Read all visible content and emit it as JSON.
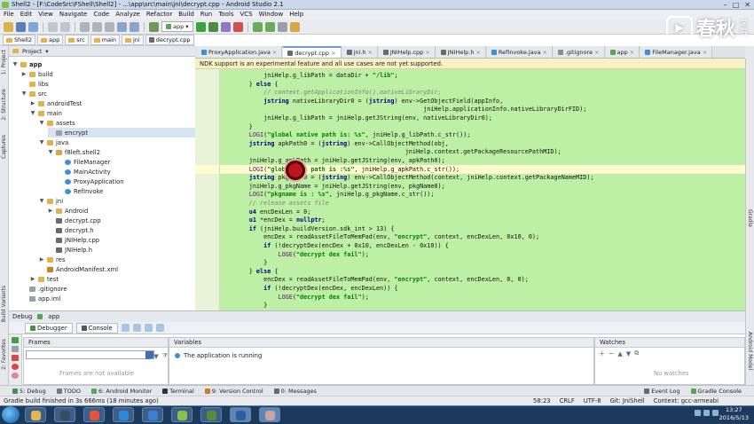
{
  "window": {
    "title": "Shell2 - [F:\\CodeSrc\\FShell\\Shell2] - ...\\app\\src\\main\\jni\\decrypt.cpp - Android Studio 2.1"
  },
  "menu": [
    "File",
    "Edit",
    "View",
    "Navigate",
    "Code",
    "Analyze",
    "Refactor",
    "Build",
    "Run",
    "Tools",
    "VCS",
    "Window",
    "Help"
  ],
  "toolbar": {
    "run_config": "app"
  },
  "watermark": {
    "text": "春秋",
    "sub": "学院"
  },
  "breadcrumb": [
    "Shell2",
    "app",
    "src",
    "main",
    "jni",
    "decrypt.cpp"
  ],
  "tabs": [
    {
      "label": "ProxyApplication.java",
      "color": "#3f8fd6",
      "active": false
    },
    {
      "label": "decrypt.cpp",
      "color": "#6a6a6a",
      "active": true
    },
    {
      "label": "jni.h",
      "color": "#6a6a6a",
      "active": false
    },
    {
      "label": "JNIHelp.cpp",
      "color": "#6a6a6a",
      "active": false
    },
    {
      "label": "JNIHelp.h",
      "color": "#6a6a6a",
      "active": false
    },
    {
      "label": "RefInvoke.java",
      "color": "#3f8fd6",
      "active": false
    },
    {
      "label": ".gitignore",
      "color": "#8c8c8c",
      "active": false
    },
    {
      "label": "app",
      "color": "#5aa35a",
      "active": false
    },
    {
      "label": "FileManager.java",
      "color": "#3f8fd6",
      "active": false
    }
  ],
  "project": {
    "header": "Project",
    "tree": [
      {
        "label": "app",
        "depth": 0,
        "arrow": "▼",
        "icon": "folder",
        "bold": true
      },
      {
        "label": "build",
        "depth": 1,
        "arrow": "▶",
        "icon": "folder"
      },
      {
        "label": "libs",
        "depth": 1,
        "arrow": "",
        "icon": "folder"
      },
      {
        "label": "src",
        "depth": 1,
        "arrow": "▼",
        "icon": "folder"
      },
      {
        "label": "androidTest",
        "depth": 2,
        "arrow": "▶",
        "icon": "folder"
      },
      {
        "label": "main",
        "depth": 2,
        "arrow": "▼",
        "icon": "folder"
      },
      {
        "label": "assets",
        "depth": 3,
        "arrow": "▼",
        "icon": "folder"
      },
      {
        "label": "encrypt",
        "depth": 4,
        "arrow": "",
        "icon": "file",
        "selected": true
      },
      {
        "label": "java",
        "depth": 3,
        "arrow": "▼",
        "icon": "folder"
      },
      {
        "label": "f8left.shell2",
        "depth": 4,
        "arrow": "▼",
        "icon": "package"
      },
      {
        "label": "FileManager",
        "depth": 5,
        "arrow": "",
        "icon": "class"
      },
      {
        "label": "MainActivity",
        "depth": 5,
        "arrow": "",
        "icon": "class"
      },
      {
        "label": "ProxyApplication",
        "depth": 5,
        "arrow": "",
        "icon": "class"
      },
      {
        "label": "RefInvoke",
        "depth": 5,
        "arrow": "",
        "icon": "class"
      },
      {
        "label": "jni",
        "depth": 3,
        "arrow": "▼",
        "icon": "folder"
      },
      {
        "label": "Android",
        "depth": 4,
        "arrow": "▶",
        "icon": "folder"
      },
      {
        "label": "decrypt.cpp",
        "depth": 4,
        "arrow": "",
        "icon": "cpp"
      },
      {
        "label": "decrypt.h",
        "depth": 4,
        "arrow": "",
        "icon": "cpp"
      },
      {
        "label": "JNIHelp.cpp",
        "depth": 4,
        "arrow": "",
        "icon": "cpp"
      },
      {
        "label": "JNIHelp.h",
        "depth": 4,
        "arrow": "",
        "icon": "cpp"
      },
      {
        "label": "res",
        "depth": 3,
        "arrow": "▶",
        "icon": "folder"
      },
      {
        "label": "AndroidManifest.xml",
        "depth": 3,
        "arrow": "",
        "icon": "xml"
      },
      {
        "label": "test",
        "depth": 2,
        "arrow": "▶",
        "icon": "folder"
      },
      {
        "label": ".gitignore",
        "depth": 1,
        "arrow": "",
        "icon": "file"
      },
      {
        "label": "app.iml",
        "depth": 1,
        "arrow": "",
        "icon": "file"
      }
    ]
  },
  "notice": "NDK support is an experimental feature and all use cases are not yet supported.",
  "code": [
    "            jniHelp.g_libPath = dataDir + \"/lib\";",
    "        } else {",
    "            // context.getApplicationInfo().nativeLibraryDir;",
    "            jstring nativeLibraryDir0 = (jstring) env->GetObjectField(appInfo,",
    "                                                        jniHelp.applicationInfo.nativeLibraryDirFID);",
    "            jniHelp.g_libPath = jniHelp.getJString(env, nativeLibraryDir0);",
    "        }",
    "        LOGI(\"global native path is: %s\", jniHelp.g_libPath.c_str());",
    "        jstring apkPath0 = (jstring) env->CallObjectMethod(obj,",
    "                                                   jniHelp.context.getPackageResourcePathMID);",
    "        jniHelp.g_apkPath = jniHelp.getJString(env, apkPath0);",
    "        LOGI(\"global apk path is :%s\", jniHelp.g_apkPath.c_str());",
    "        jstring pkgName0 = (jstring) env->CallObjectMethod(context, jniHelp.context.getPackageNameMID);",
    "        jniHelp.g_pkgName = jniHelp.getJString(env, pkgName0);",
    "        LOGI(\"pkgname is : %s\", jniHelp.g_pkgName.c_str());",
    "        // release assets file",
    "        u4 encDexLen = 0;",
    "        u1 *encDex = nullptr;",
    "        if (jniHelp.buildVersion.sdk_int > 13) {",
    "            encDex = readAssetFileToMemPad(env, \"encrypt\", context, encDexLen, 0x10, 0);",
    "            if (!decryptDex(encDex + 0x10, encDexLen - 0x10)) {",
    "                LOGE(\"decrypt dex fail\");",
    "            }",
    "        } else {",
    "            encDex = readAssetFileToMemPad(env, \"encrypt\", context, encDexLen, 0, 0);",
    "            if (!decryptDex(encDex, encDexLen)) {",
    "                LOGE(\"decrypt dex fail\");",
    "            }"
  ],
  "debug": {
    "bar_label": "Debug",
    "config": "app",
    "tabs": [
      "Debugger",
      "Console"
    ],
    "frames_title": "Frames",
    "frames_empty": "Frames are not available",
    "variables_title": "Variables",
    "variables_msg": "The application is running",
    "watches_title": "Watches",
    "watches_empty": "No watches"
  },
  "toolwindows": [
    {
      "label": "5: Debug",
      "color": "#4a8f4a"
    },
    {
      "label": "TODO",
      "color": "#7a7a7a"
    },
    {
      "label": "6: Android Monitor",
      "color": "#5aa35a"
    },
    {
      "label": "Terminal",
      "color": "#333333"
    },
    {
      "label": "9: Version Control",
      "color": "#c77b2b"
    },
    {
      "label": "0: Messages",
      "color": "#6a6a6a"
    }
  ],
  "toolwindows_right": [
    {
      "label": "Event Log",
      "color": "#6a6a6a"
    },
    {
      "label": "Gradle Console",
      "color": "#5aa35a"
    }
  ],
  "status": {
    "message": "Gradle build finished in 3s 666ms (18 minutes ago)",
    "position": "58:23",
    "line_sep": "CRLF",
    "encoding": "UTF-8",
    "vcs": "Git: JniShell",
    "context": "Context: gcc-armeabi"
  },
  "sidebar_left": [
    "1: Project",
    "2: Structure",
    "Captures",
    "Build Variants",
    "2: Favorites"
  ],
  "sidebar_right": [
    "Gradle",
    "Android Model"
  ],
  "taskbar": {
    "time": "13:27",
    "date": "2016/5/13",
    "apps": [
      "explorer",
      "aliens",
      "chrome",
      "qq",
      "wps",
      "android",
      "media",
      "ps",
      "user"
    ]
  },
  "colors": {
    "code_bg": "#bdf0a5",
    "accent": "#6d9ed8",
    "taskbar": "#1d3a5c"
  }
}
